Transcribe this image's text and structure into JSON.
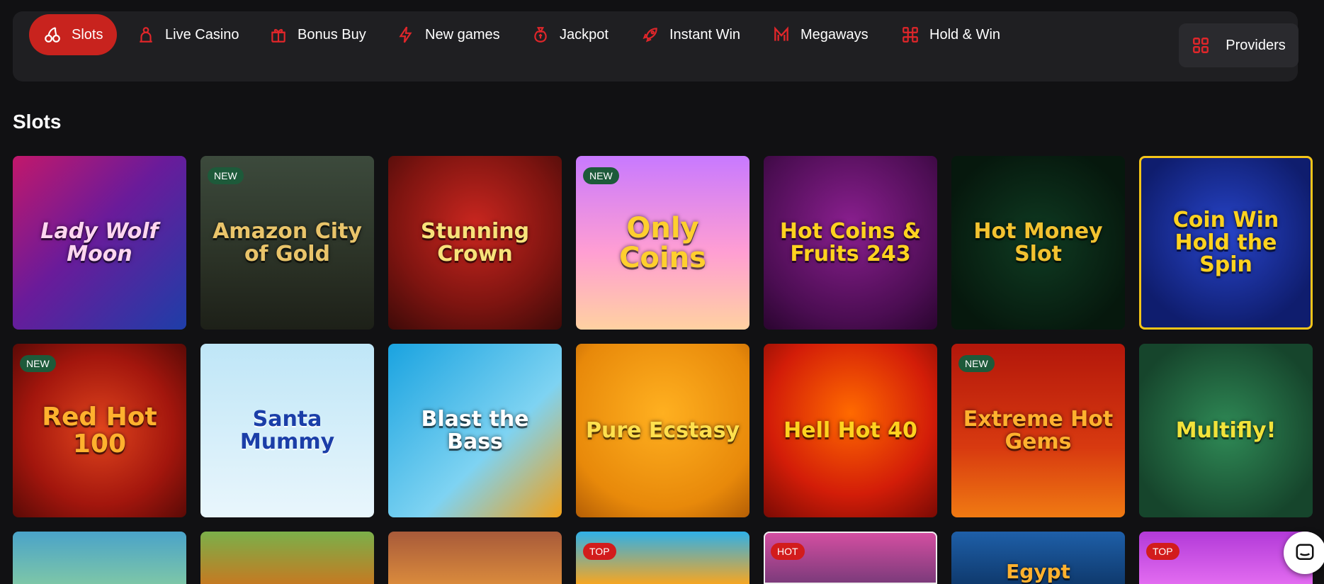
{
  "nav": {
    "items": [
      {
        "label": "Slots",
        "icon": "cherry-icon",
        "active": true
      },
      {
        "label": "Live Casino",
        "icon": "dealer-icon"
      },
      {
        "label": "Bonus Buy",
        "icon": "gift-icon"
      },
      {
        "label": "New games",
        "icon": "lightning-icon"
      },
      {
        "label": "Jackpot",
        "icon": "money-bag-icon"
      },
      {
        "label": "Instant Win",
        "icon": "rocket-icon"
      },
      {
        "label": "Megaways",
        "icon": "megaways-icon"
      },
      {
        "label": "Hold & Win",
        "icon": "hold-win-icon"
      }
    ],
    "providers_label": "Providers",
    "providers_icon": "grid-icon",
    "accent_color": "#c8231e"
  },
  "section_title": "Slots",
  "games": [
    {
      "title": "Lady Wolf Moon",
      "badge": ""
    },
    {
      "title": "Amazon City of Gold",
      "badge": "NEW"
    },
    {
      "title": "Stunning Crown",
      "badge": ""
    },
    {
      "title": "Only Coins",
      "badge": "NEW"
    },
    {
      "title": "Hot Coins & Fruits 243",
      "badge": ""
    },
    {
      "title": "Hot Money Slot",
      "badge": ""
    },
    {
      "title": "Coin Win Hold the Spin",
      "badge": ""
    },
    {
      "title": "Red Hot 100",
      "badge": "NEW"
    },
    {
      "title": "Santa Mummy",
      "badge": ""
    },
    {
      "title": "Blast the Bass",
      "badge": ""
    },
    {
      "title": "Pure Ecstasy",
      "badge": ""
    },
    {
      "title": "Hell Hot 40",
      "badge": ""
    },
    {
      "title": "Extreme Hot Gems",
      "badge": "NEW"
    },
    {
      "title": "Multifly!",
      "badge": ""
    },
    {
      "title": "",
      "badge": ""
    },
    {
      "title": "",
      "badge": ""
    },
    {
      "title": "",
      "badge": ""
    },
    {
      "title": "",
      "badge": "TOP"
    },
    {
      "title": "",
      "badge": "HOT"
    },
    {
      "title": "Egypt",
      "badge": ""
    },
    {
      "title": "",
      "badge": "TOP"
    }
  ],
  "chat_icon": "chat-icon"
}
